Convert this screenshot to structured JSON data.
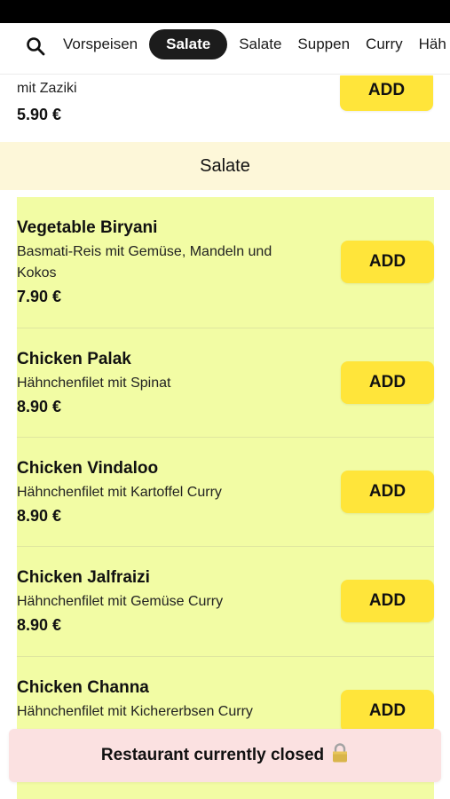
{
  "nav": {
    "tabs": [
      {
        "label": "Vorspeisen",
        "active": false
      },
      {
        "label": "Salate",
        "active": true
      },
      {
        "label": "Salate",
        "active": false
      },
      {
        "label": "Suppen",
        "active": false
      },
      {
        "label": "Curry",
        "active": false
      },
      {
        "label": "Häh",
        "active": false
      }
    ],
    "search_icon": "search-icon"
  },
  "previous_item": {
    "desc": "mit Zaziki",
    "price": "5.90 €",
    "add_label": "ADD"
  },
  "section": {
    "title": "Salate",
    "items": [
      {
        "name": "Vegetable Biryani",
        "desc": "Basmati-Reis mit Gemüse, Mandeln und Kokos",
        "price": "7.90 €",
        "add_label": "ADD"
      },
      {
        "name": "Chicken Palak",
        "desc": "Hähnchenfilet mit Spinat",
        "price": "8.90 €",
        "add_label": "ADD"
      },
      {
        "name": "Chicken Vindaloo",
        "desc": "Hähnchenfilet mit Kartoffel Curry",
        "price": "8.90 €",
        "add_label": "ADD"
      },
      {
        "name": "Chicken Jalfraizi",
        "desc": "Hähnchenfilet mit Gemüse Curry",
        "price": "8.90 €",
        "add_label": "ADD"
      },
      {
        "name": "Chicken Channa",
        "desc": "Hähnchenfilet mit Kichererbsen Curry",
        "price": "",
        "add_label": "ADD"
      }
    ]
  },
  "banner": {
    "text": "Restaurant currently closed",
    "icon": "lock-icon"
  },
  "colors": {
    "accent": "#ffe53a",
    "section_header_bg": "#fdf7d9",
    "section_body_bg": "#f2fca4",
    "banner_bg": "#fbe1e1",
    "active_tab_bg": "#1c1c1c"
  }
}
